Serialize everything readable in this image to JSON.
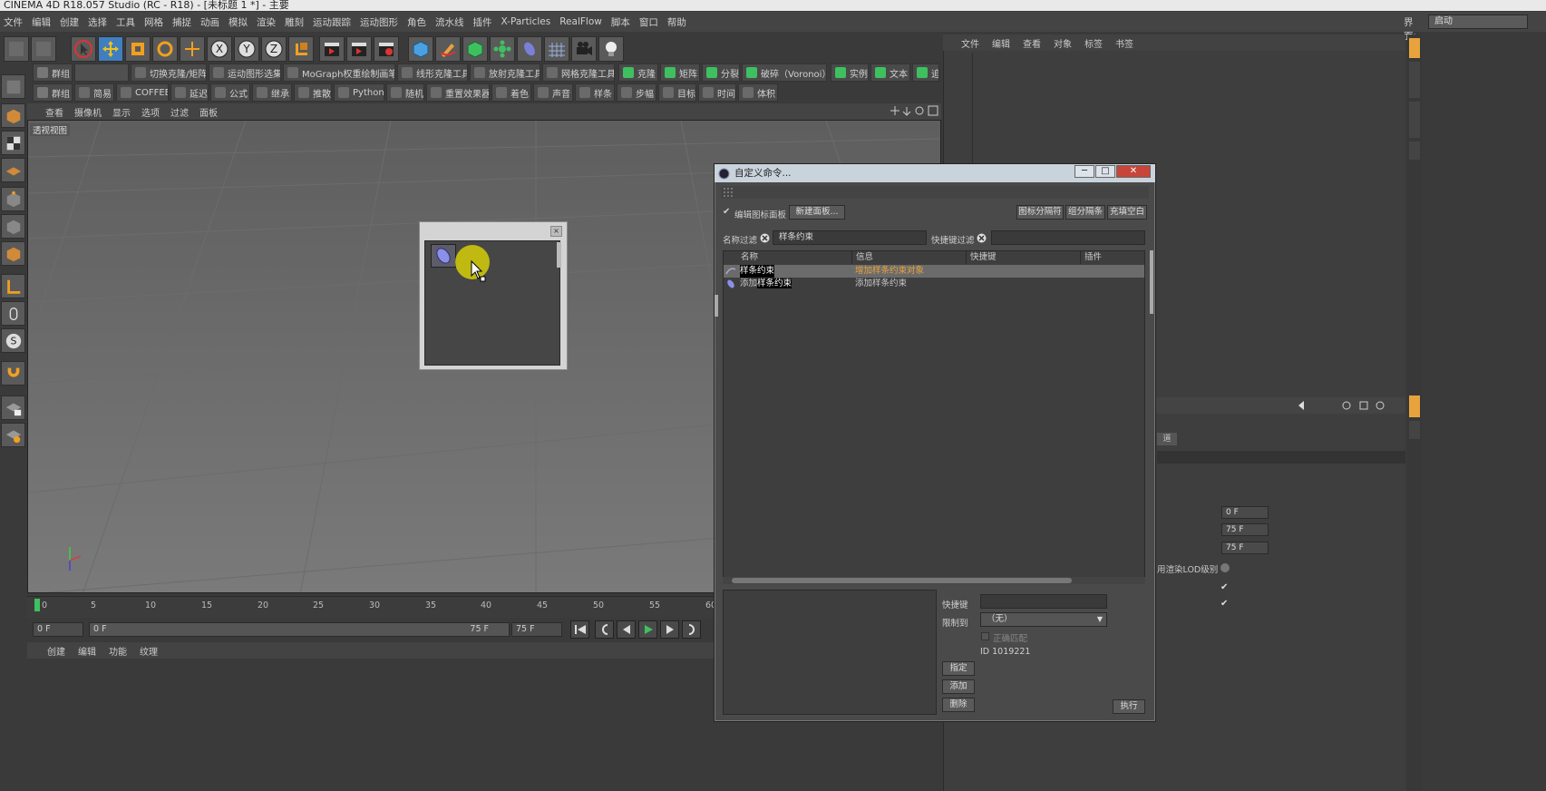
{
  "window": {
    "title": "CINEMA 4D R18.057 Studio (RC - R18) - [未标题 1 *] - 主要"
  },
  "menubar": [
    "文件",
    "编辑",
    "创建",
    "选择",
    "工具",
    "网格",
    "捕捉",
    "动画",
    "模拟",
    "渲染",
    "雕刻",
    "运动跟踪",
    "运动图形",
    "角色",
    "流水线",
    "插件",
    "X-Particles",
    "RealFlow",
    "脚本",
    "窗口",
    "帮助"
  ],
  "layout": {
    "label": "界面:",
    "value": "启动"
  },
  "palette_row1": [
    "群组",
    "",
    "切换克隆/矩阵",
    "运动图形选集",
    "MoGraph权重绘制画笔",
    "线形克隆工具",
    "放射克隆工具",
    "网格克隆工具",
    "克隆",
    "矩阵",
    "分裂",
    "破碎（Voronoi）",
    "实例",
    "文本",
    "追"
  ],
  "palette_row2": [
    "群组",
    "简易",
    "COFFEE",
    "延迟",
    "公式",
    "继承",
    "推散",
    "Python",
    "随机",
    "重置效果器",
    "着色",
    "声音",
    "样条",
    "步幅",
    "目标",
    "时间",
    "体积"
  ],
  "viewport": {
    "menu": [
      "查看",
      "摄像机",
      "显示",
      "选项",
      "过滤",
      "面板"
    ],
    "label": "透视视图"
  },
  "timeline": {
    "ticks": [
      "0",
      "5",
      "10",
      "15",
      "20",
      "25",
      "30",
      "35",
      "40",
      "45",
      "50",
      "55",
      "60"
    ],
    "start": "0 F",
    "range_start": "0 F",
    "range_end": "75 F",
    "end": "75 F"
  },
  "material_menu": [
    "创建",
    "编辑",
    "功能",
    "纹理"
  ],
  "object_manager_menu": [
    "文件",
    "编辑",
    "查看",
    "对象",
    "标签",
    "书签"
  ],
  "attributes": {
    "tab_partial": "道",
    "fields": [
      "0 F",
      "75 F",
      "75 F"
    ],
    "lod_label": "用渲染LOD级别",
    "checks": [
      "✔",
      "✔"
    ]
  },
  "dialog": {
    "title": "自定义命令...",
    "edit_palette_label": "编辑图标面板",
    "new_palette_btn": "新建面板...",
    "btn_separator": "图标分隔符",
    "btn_group_sep": "组分隔条",
    "btn_fill_space": "充填空白",
    "name_filter_label": "名称过滤",
    "name_filter_value": "样条约束",
    "shortcut_filter_label": "快捷键过滤",
    "shortcut_filter_value": "",
    "columns": [
      "名称",
      "信息",
      "快捷键",
      "插件"
    ],
    "rows": [
      {
        "name": "样条约束",
        "info": "增加样条约束对象"
      },
      {
        "name_prefix": "添加",
        "name_hl": "样条约束",
        "info": "添加样条约束"
      }
    ],
    "shortcut_label": "快捷键",
    "shortcut_value": "",
    "restrict_label": "限制到",
    "restrict_value": "（无）",
    "exact_label": "正确匹配",
    "id_text": "ID 1019221",
    "assign_btn": "指定",
    "add_btn": "添加",
    "delete_btn": "删除",
    "execute_btn": "执行"
  },
  "colors": {
    "accent_blue": "#5aa0d8",
    "info_orange": "#e8a33c",
    "cursor_yellow": "#e8e000"
  }
}
